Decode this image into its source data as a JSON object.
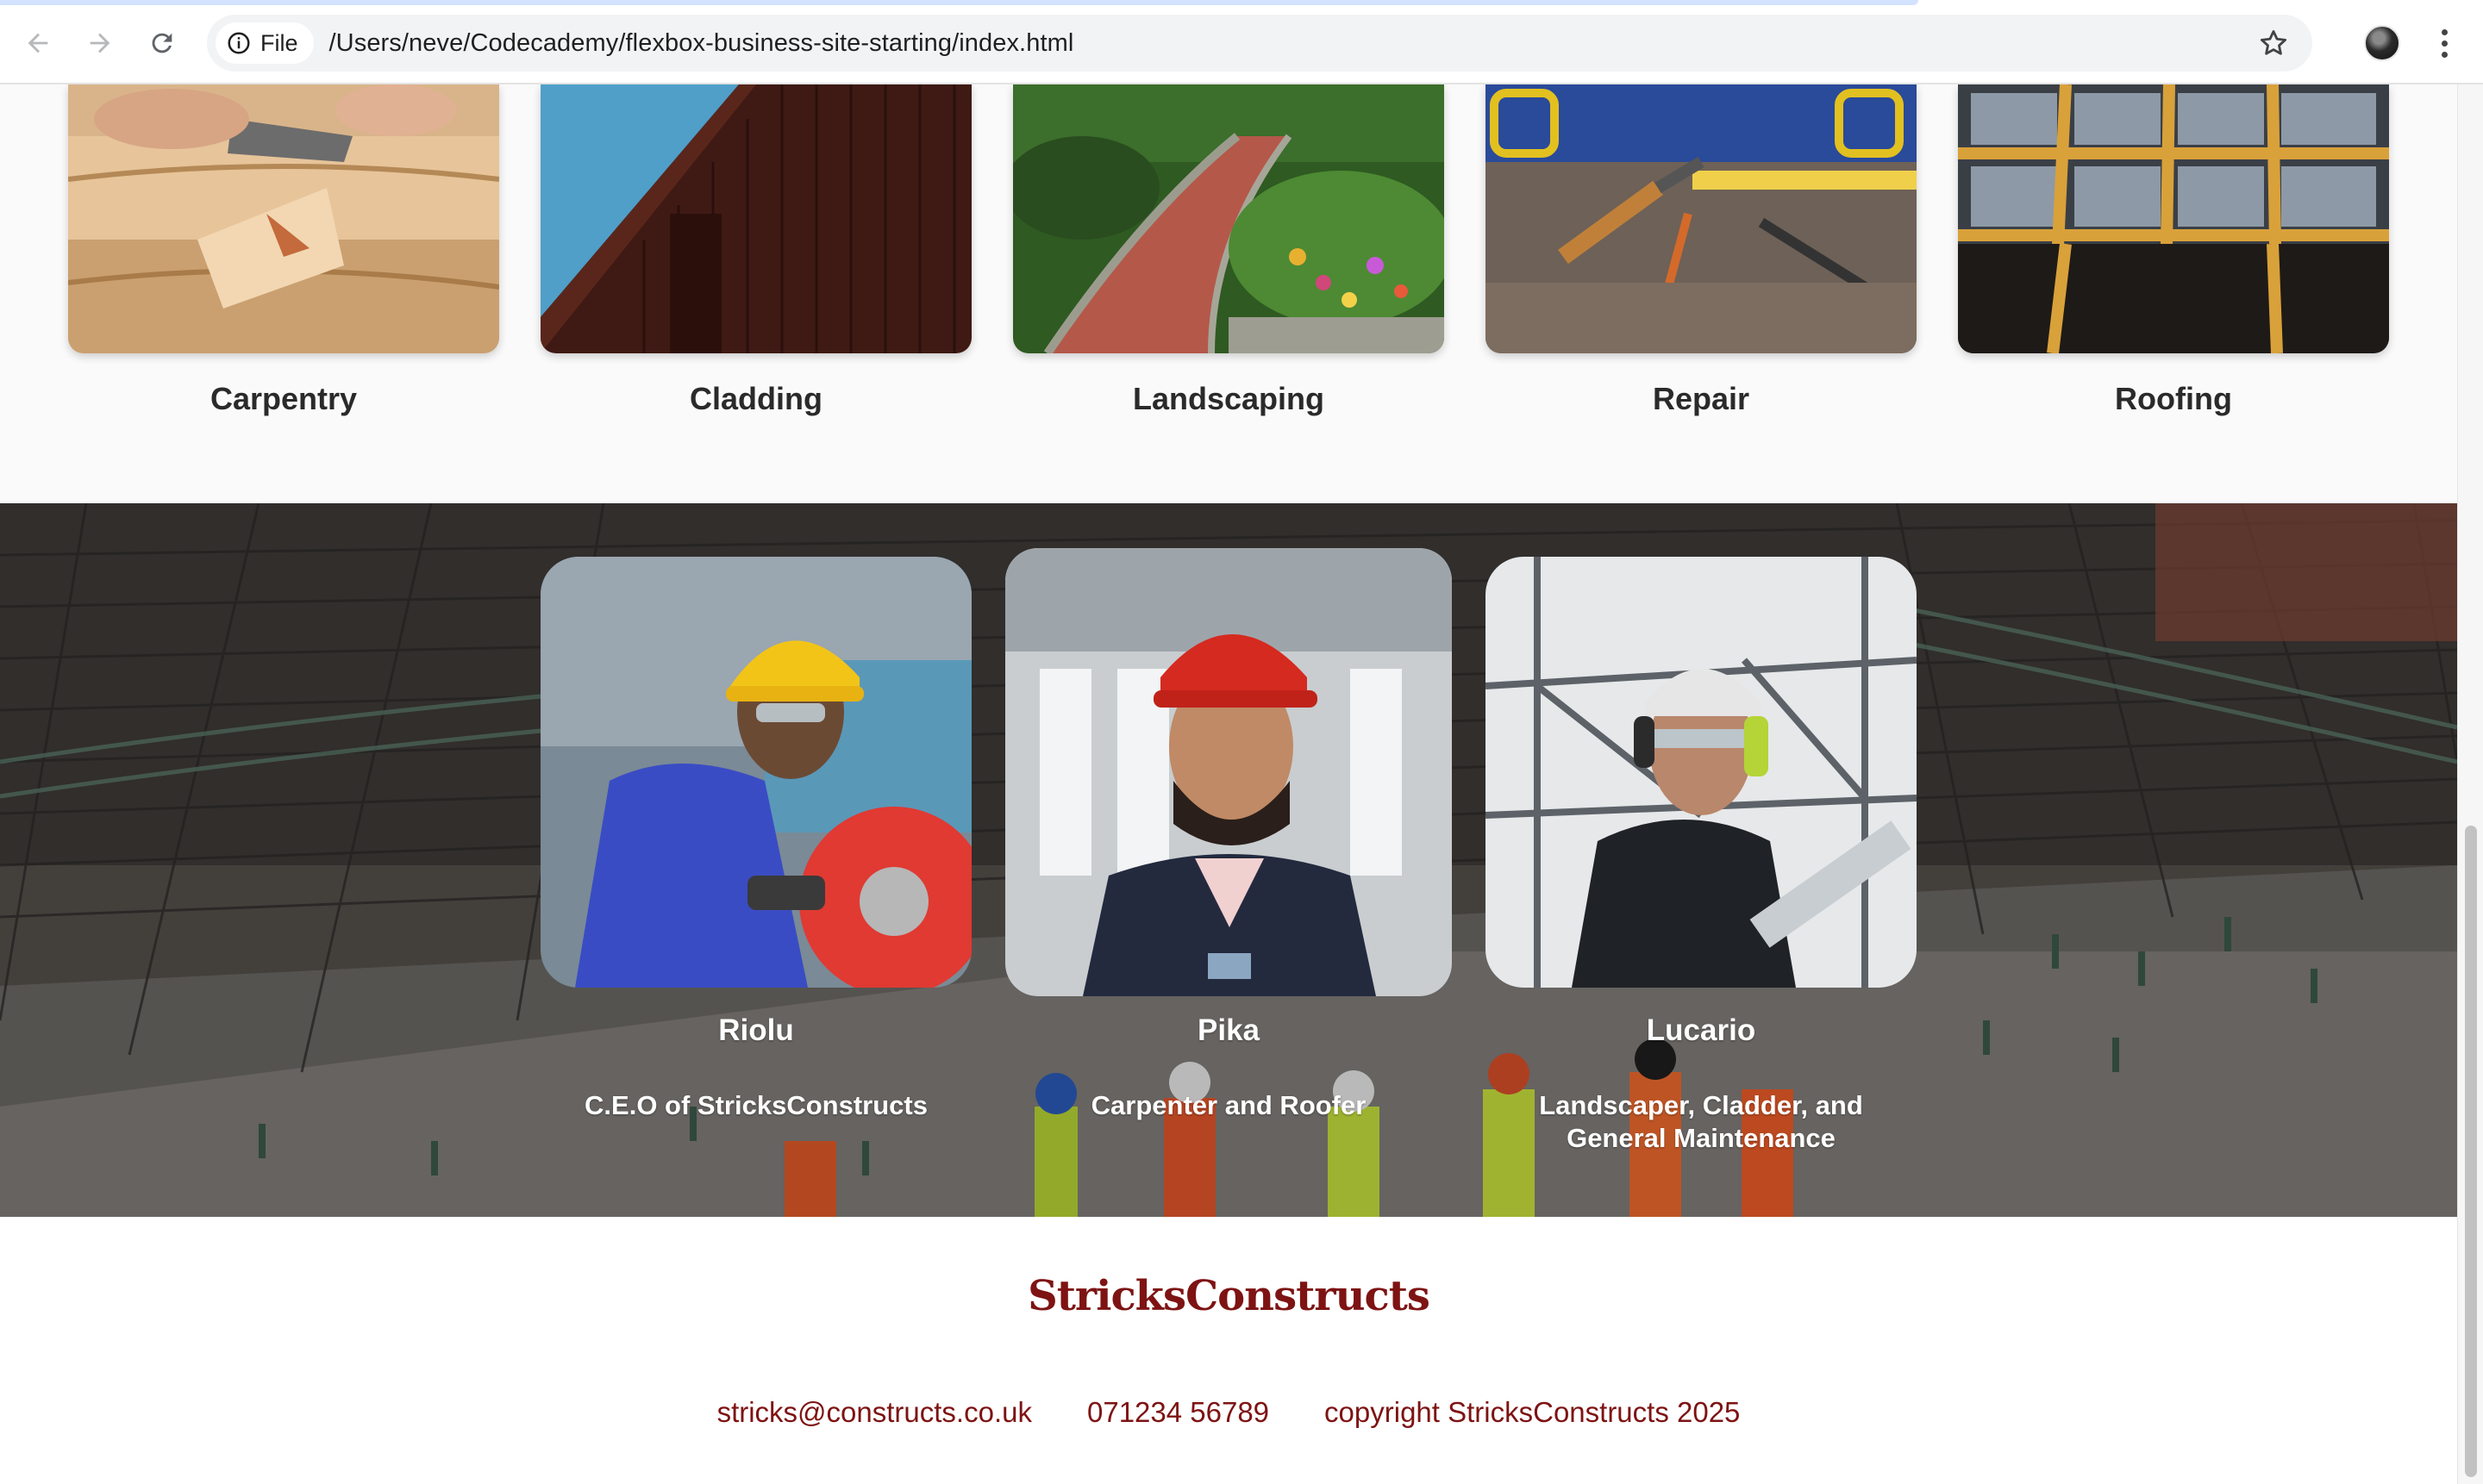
{
  "browser": {
    "site_chip_label": "File",
    "url": "/Users/neve/Codecademy/flexbox-business-site-starting/index.html"
  },
  "services": [
    {
      "title": "Carpentry"
    },
    {
      "title": "Cladding"
    },
    {
      "title": "Landscaping"
    },
    {
      "title": "Repair"
    },
    {
      "title": "Roofing"
    }
  ],
  "team": [
    {
      "name": "Riolu",
      "role": "C.E.O of StricksConstructs"
    },
    {
      "name": "Pika",
      "role": "Carpenter and Roofer"
    },
    {
      "name": "Lucario",
      "role": "Landscaper, Cladder, and General Maintenance"
    }
  ],
  "footer": {
    "brand": "StricksConstructs",
    "email": "stricks@constructs.co.uk",
    "phone": "071234 56789",
    "copyright": "copyright StricksConstructs 2025"
  },
  "colors": {
    "brand": "#7e1313",
    "service_title": "#2a2a2a"
  }
}
